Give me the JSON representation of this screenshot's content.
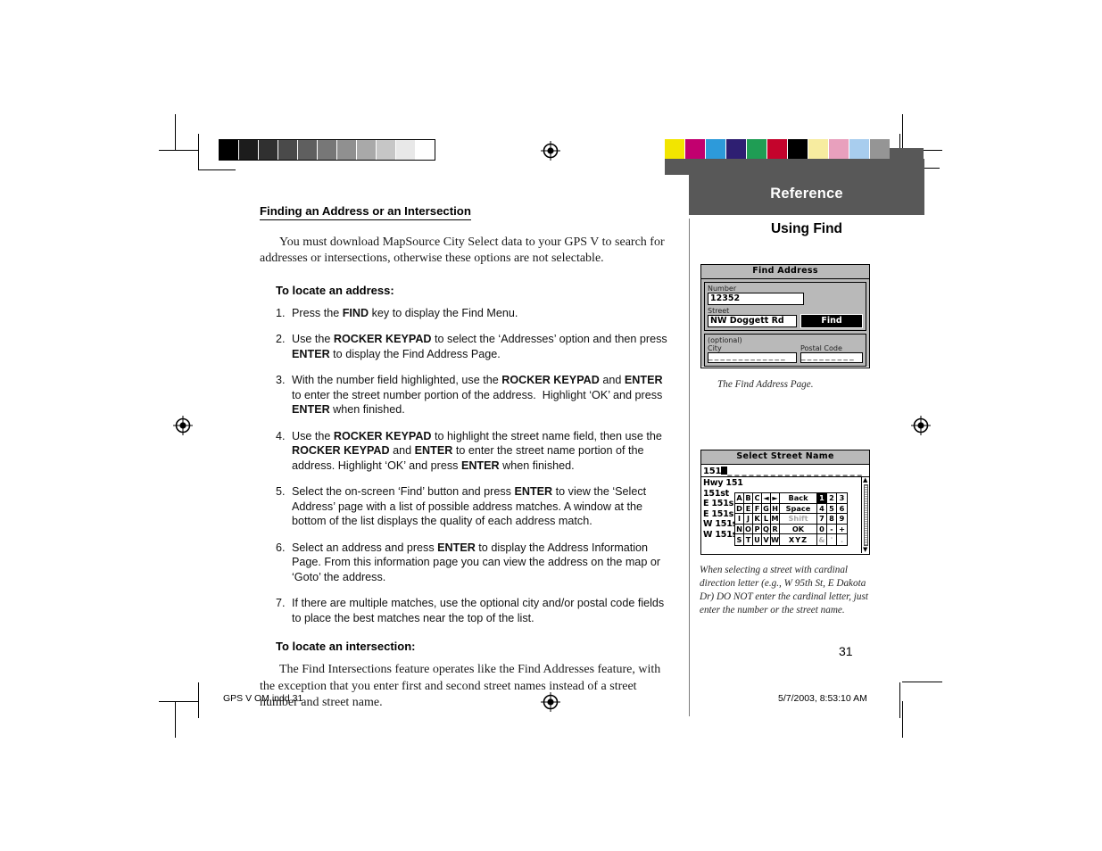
{
  "document": {
    "page_number": "31",
    "footer_left": "GPS V OM.indd   31",
    "footer_right": "5/7/2003, 8:53:10 AM"
  },
  "sidebar": {
    "band_title": "Reference",
    "section_title": "Using Find",
    "caption_1": "The Find Address Page.",
    "caption_2": "When selecting a street with cardinal direction letter (e.g., W 95th St, E Dakota Dr) DO NOT enter the cardinal letter, just enter the number or the street name.",
    "band_color": "#585858"
  },
  "main": {
    "section_heading": "Finding an Address or an Intersection",
    "intro": "You must download MapSource City Select data to your GPS V to search for addresses or intersections, otherwise these options are not selectable.",
    "sub_heading_1": "To locate an address:",
    "steps": [
      {
        "num": "1.",
        "html": "Press the <b>FIND</b> key to display the Find Menu."
      },
      {
        "num": "2.",
        "html": "Use the <b>ROCKER KEYPAD</b> to select the &lsquo;Addresses&rsquo; option and then press <b>ENTER</b> to display the Find Address Page."
      },
      {
        "num": "3.",
        "html": "With the number field highlighted, use the <b>ROCKER KEYPAD</b> and <b>ENTER</b> to enter the street number portion of the address.&nbsp; Highlight &lsquo;OK&rsquo; and press <b>ENTER</b> when finished."
      },
      {
        "num": "4.",
        "html": "Use the <b>ROCKER KEYPAD</b> to highlight the street name field, then use the <b>ROCKER KEYPAD</b> and <b>ENTER</b> to enter the street name portion of the address. Highlight &lsquo;OK&rsquo; and press <b>ENTER</b> when finished."
      },
      {
        "num": "5.",
        "html": "Select the on-screen &lsquo;Find&rsquo; button and press <b>ENTER</b> to view the &lsquo;Select Address&rsquo; page with a list of possible address matches. A window at the bottom of the list displays the quality of each address match."
      },
      {
        "num": "6.",
        "html": "Select an address and press <b>ENTER</b> to display the Address Information Page. From this information page you can view the address on the map or &lsquo;Goto&rsquo; the address."
      },
      {
        "num": "7.",
        "html": "If there are multiple matches, use the optional city and/or postal code fields to place the best matches near the top of the list."
      }
    ],
    "sub_heading_2": "To locate an intersection:",
    "closing": "The Find Intersections feature operates like the Find Addresses feature, with the exception that you enter first and second street names instead of a street number and street name."
  },
  "find_address_screen": {
    "title": "Find Address",
    "number_label": "Number",
    "number_value": "12352",
    "street_label": "Street",
    "street_value": "NW Doggett Rd",
    "find_button": "Find",
    "optional_label": "(optional)",
    "city_label": "City",
    "city_value": "_ _ _ _ _ _ _ _ _ _ _ _ _",
    "postal_label": "Postal Code",
    "postal_value": "_ _ _ _ _ _ _ _ _"
  },
  "select_street_screen": {
    "title": "Select Street Name",
    "input_value": "151",
    "input_trail": "_ _ _ _ _ _ _ _ _ _ _ _ _ _ _ _ _ _ _",
    "list_items": [
      "Hwy 151",
      "151st",
      "E 151s",
      "E 151s",
      "W 151s",
      "W 151s"
    ],
    "keypad_rows": [
      [
        {
          "t": "A"
        },
        {
          "t": "B"
        },
        {
          "t": "C"
        },
        {
          "t": "◄"
        },
        {
          "t": "►"
        },
        {
          "t": "Back"
        },
        {
          "t": "1",
          "sel": true
        },
        {
          "t": "2"
        },
        {
          "t": "3"
        }
      ],
      [
        {
          "t": "D"
        },
        {
          "t": "E"
        },
        {
          "t": "F"
        },
        {
          "t": "G"
        },
        {
          "t": "H"
        },
        {
          "t": "Space"
        },
        {
          "t": "4"
        },
        {
          "t": "5"
        },
        {
          "t": "6"
        }
      ],
      [
        {
          "t": "I"
        },
        {
          "t": "J"
        },
        {
          "t": "K"
        },
        {
          "t": "L"
        },
        {
          "t": "M"
        },
        {
          "t": "Shift",
          "dim": true
        },
        {
          "t": "7"
        },
        {
          "t": "8"
        },
        {
          "t": "9"
        }
      ],
      [
        {
          "t": "N"
        },
        {
          "t": "O"
        },
        {
          "t": "P"
        },
        {
          "t": "Q"
        },
        {
          "t": "R"
        },
        {
          "t": "OK"
        },
        {
          "t": "0"
        },
        {
          "t": "-"
        },
        {
          "t": "+"
        }
      ],
      [
        {
          "t": "S"
        },
        {
          "t": "T"
        },
        {
          "t": "U"
        },
        {
          "t": "V"
        },
        {
          "t": "W"
        },
        {
          "t": "XYZ"
        },
        {
          "t": "&",
          "dim": true
        },
        {
          "t": "'",
          "dim": true
        },
        {
          "t": ".",
          "dim": true
        }
      ]
    ]
  },
  "calibration": {
    "grayscale": [
      "#000000",
      "#1c1c1c",
      "#303030",
      "#4a4a4a",
      "#5f5f5f",
      "#777777",
      "#909090",
      "#a9a9a9",
      "#c6c6c6",
      "#e8e8e8",
      "#ffffff"
    ],
    "colors": [
      "#f2e500",
      "#c2006f",
      "#2d9ada",
      "#2e1f72",
      "#1f9d54",
      "#c4042c",
      "#000000",
      "#f7eca0",
      "#e8a0bd",
      "#a8cdee",
      "#959595"
    ]
  }
}
